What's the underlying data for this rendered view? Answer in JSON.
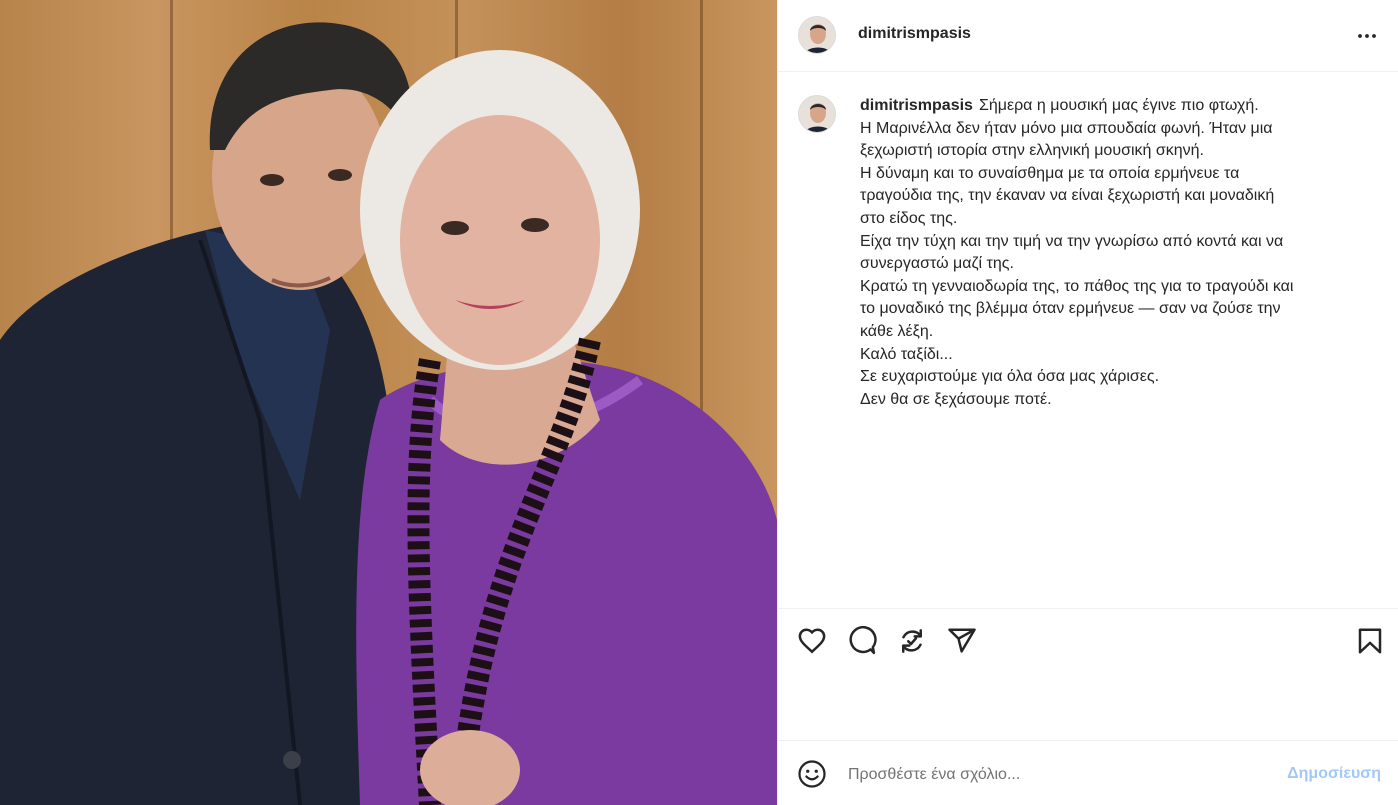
{
  "post": {
    "username": "dimitrismpasis",
    "image_alt": "Two people posing together in front of a wooden wall"
  },
  "header": {
    "username": "dimitrismpasis",
    "more_icon": "more-horizontal-icon"
  },
  "caption": {
    "username": "dimitrismpasis",
    "lines": [
      "Σήμερα η μουσική μας έγινε πιο φτωχή.",
      "Η Μαρινέλλα δεν ήταν μόνο μια σπουδαία φωνή. Ήταν μια",
      "ξεχωριστή ιστορία στην ελληνική μουσική σκηνή.",
      "Η δύναμη και το συναίσθημα με τα οποία ερμήνευε τα",
      "τραγούδια της, την έκαναν να είναι ξεχωριστή και μοναδική",
      "στο είδος της.",
      "Είχα την τύχη και την τιμή να την γνωρίσω από κοντά και να",
      "συνεργαστώ μαζί της.",
      "Κρατώ τη γενναιοδωρία της, το πάθος της για το τραγούδι και",
      "το μοναδικό της βλέμμα όταν ερμήνευε — σαν να ζούσε την",
      "κάθε λέξη.",
      "Καλό ταξίδι...",
      "Σε ευχαριστούμε για όλα όσα μας χάρισες.",
      "Δεν θα σε ξεχάσουμε ποτέ."
    ]
  },
  "actions": {
    "like_icon": "heart-icon",
    "comment_icon": "comment-icon",
    "repost_icon": "repost-icon",
    "share_icon": "share-icon",
    "save_icon": "bookmark-icon"
  },
  "comment_box": {
    "emoji_icon": "emoji-icon",
    "placeholder": "Προσθέστε ένα σχόλιο...",
    "post_label": "Δημοσίευση"
  },
  "colors": {
    "text": "#262626",
    "muted": "#737373",
    "border": "#efefef",
    "post_button_disabled": "#a3c8f7"
  }
}
